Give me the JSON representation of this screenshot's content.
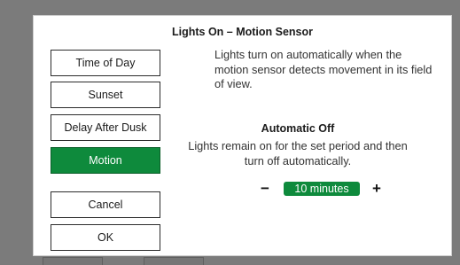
{
  "dialog": {
    "title": "Lights On – Motion Sensor",
    "modes": [
      {
        "label": "Time of Day",
        "selected": false
      },
      {
        "label": "Sunset",
        "selected": false
      },
      {
        "label": "Delay After Dusk",
        "selected": false
      },
      {
        "label": "Motion",
        "selected": true
      }
    ],
    "description": "Lights turn on automatically when the motion sensor detects movement in its field of view.",
    "auto_off": {
      "title": "Automatic Off",
      "description": "Lights remain on for the set period and then turn off automatically.",
      "decrement_label": "−",
      "value": "10 minutes",
      "increment_label": "+"
    },
    "cancel_label": "Cancel",
    "ok_label": "OK"
  },
  "colors": {
    "accent": "#0e8a3c",
    "backdrop": "#7b7b7b",
    "dialog_bg": "#ffffff"
  }
}
